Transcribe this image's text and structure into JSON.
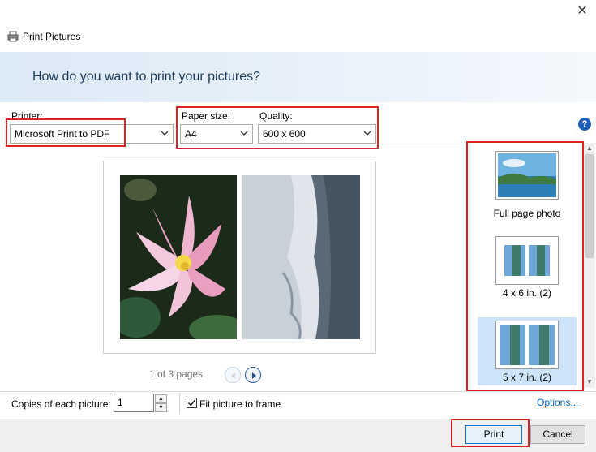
{
  "window": {
    "title": "Print Pictures",
    "close_glyph": "✕"
  },
  "header": {
    "question": "How do you want to print your pictures?"
  },
  "printer": {
    "label": "Printer:",
    "value": "Microsoft Print to PDF"
  },
  "paper_size": {
    "label": "Paper size:",
    "value": "A4"
  },
  "quality": {
    "label": "Quality:",
    "value": "600 x 600"
  },
  "help": {
    "glyph": "?"
  },
  "preview": {
    "page_indicator": "1 of 3 pages"
  },
  "layouts": {
    "items": [
      {
        "label": "Full page photo",
        "selected": false
      },
      {
        "label": "4 x 6 in. (2)",
        "selected": false
      },
      {
        "label": "5 x 7 in. (2)",
        "selected": true
      }
    ]
  },
  "options": {
    "copies_label": "Copies of each picture:",
    "copies_value": "1",
    "fit_label": "Fit picture to frame",
    "fit_checked": true,
    "options_link": "Options..."
  },
  "buttons": {
    "print": "Print",
    "cancel": "Cancel"
  },
  "colors": {
    "highlight_border": "#dd2222",
    "selected_layout_bg": "#cde4fa",
    "link": "#0066cc",
    "header_text": "#1e3b5c"
  }
}
